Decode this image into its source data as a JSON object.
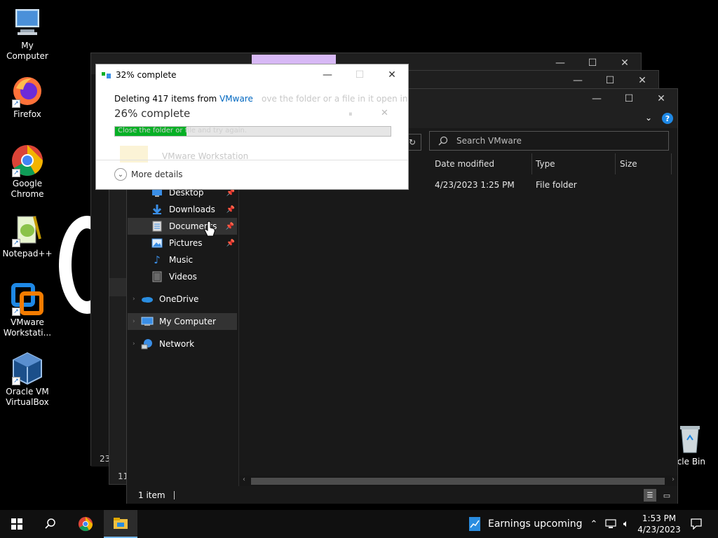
{
  "desktop_icons": [
    {
      "label": "My Computer",
      "icon": "computer-icon"
    },
    {
      "label": "Firefox",
      "icon": "firefox-icon"
    },
    {
      "label": "Google Chrome",
      "icon": "chrome-icon"
    },
    {
      "label": "Notepad++",
      "icon": "notepadpp-icon"
    },
    {
      "label": "VMware Workstati...",
      "icon": "vmware-icon"
    },
    {
      "label": "Oracle VM VirtualBox",
      "icon": "virtualbox-icon"
    },
    {
      "label": "cycle Bin",
      "icon": "recycle-bin-icon"
    }
  ],
  "background_windows": {
    "side_labels": [
      "23",
      "11"
    ]
  },
  "dialog": {
    "title": "32% complete",
    "deleting_prefix": "Deleting 417 items from ",
    "deleting_source": "VMware",
    "deleting_ghost": "ove the folder or a file in it open in",
    "percent_text": "26% complete",
    "bar_ghost": "Close the folder or file and try again.",
    "item_ghost": "VMware Workstation",
    "progress": 0.26,
    "more_details": "More details",
    "accent": "#0067c0",
    "progress_color": "#06b025"
  },
  "explorer": {
    "search_placeholder": "Search VMware",
    "columns": [
      "Date modified",
      "Type",
      "Size"
    ],
    "row": {
      "date": "4/23/2023 1:25 PM",
      "type": "File folder"
    },
    "quick_access": [
      {
        "label": "Desktop",
        "icon": "desktop-folder-icon",
        "pinned": true
      },
      {
        "label": "Downloads",
        "icon": "downloads-icon",
        "pinned": true
      },
      {
        "label": "Documents",
        "icon": "documents-icon",
        "pinned": true
      },
      {
        "label": "Pictures",
        "icon": "pictures-icon",
        "pinned": true
      },
      {
        "label": "Music",
        "icon": "music-icon",
        "pinned": false
      },
      {
        "label": "Videos",
        "icon": "videos-icon",
        "pinned": false
      }
    ],
    "tree": [
      {
        "label": "OneDrive",
        "icon": "onedrive-icon"
      },
      {
        "label": "My Computer",
        "icon": "computer-icon"
      },
      {
        "label": "Network",
        "icon": "network-icon"
      }
    ],
    "status": "1 item"
  },
  "taskbar": {
    "news_label": "Earnings upcoming",
    "time": "1:53 PM",
    "date": "4/23/2023"
  }
}
